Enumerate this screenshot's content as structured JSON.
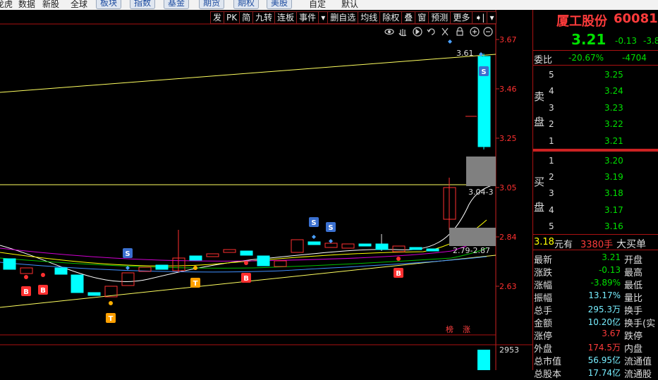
{
  "top_nav": [
    "龙虎",
    "数据",
    "新股",
    "全球",
    "板块",
    "指数",
    "基金",
    "期货",
    "期权",
    "美股",
    "自定",
    "默认"
  ],
  "toolbar": [
    "发",
    "PK",
    "简",
    "九转",
    "连板",
    "事件",
    "▾",
    "删自选",
    "均线",
    "除权",
    "叠",
    "窗",
    "预测",
    "更多",
    "➧|",
    "▾"
  ],
  "chart": {
    "price_axis": [
      "3.67",
      "3.46",
      "3.25",
      "3.05",
      "2.84",
      "2.63"
    ],
    "volume_label": "2953",
    "labels": {
      "high_price": "3.61",
      "mid_range": "3.04-3",
      "low_range": "2.79-2.87"
    },
    "tags": {
      "bang": "榜",
      "zhang": "涨"
    },
    "markers": {
      "buy": "B",
      "sell": "S",
      "t": "T"
    },
    "colors": {
      "up": "#ff3030",
      "down": "#00ffff",
      "axis": "#ff2020",
      "ma_white": "#ffffff",
      "ma_yellow": "#ffff00",
      "ma_purple": "#d000d0",
      "ma_green": "#00c000",
      "ma_blue": "#4090ff"
    }
  },
  "stock": {
    "name": "厦工股份",
    "code": "60081",
    "price": "3.21",
    "change": "-0.13",
    "change_pct": "-3.8"
  },
  "weibi": {
    "label": "委比",
    "pct": "-20.67%",
    "diff": "-4704"
  },
  "sell_side": {
    "label1": "卖",
    "label2": "盘",
    "levels": [
      {
        "n": "5",
        "price": "3.25"
      },
      {
        "n": "4",
        "price": "3.24"
      },
      {
        "n": "3",
        "price": "3.23"
      },
      {
        "n": "2",
        "price": "3.22"
      },
      {
        "n": "1",
        "price": "3.21"
      }
    ]
  },
  "buy_side": {
    "label1": "买",
    "label2": "盘",
    "levels": [
      {
        "n": "1",
        "price": "3.20"
      },
      {
        "n": "2",
        "price": "3.19"
      },
      {
        "n": "3",
        "price": "3.18"
      },
      {
        "n": "4",
        "price": "3.17"
      },
      {
        "n": "5",
        "price": "3.16"
      }
    ]
  },
  "big_order": {
    "price": "3.18",
    "unit": "元有",
    "vol": "3380手",
    "label": "大买单"
  },
  "stats": [
    {
      "k": "最新",
      "v": "3.21",
      "k2": "开盘"
    },
    {
      "k": "涨跌",
      "v": "-0.13",
      "k2": "最高"
    },
    {
      "k": "涨幅",
      "v": "-3.89%",
      "k2": "最低"
    },
    {
      "k": "振幅",
      "v": "13.17%",
      "k2": "量比"
    },
    {
      "k": "总手",
      "v": "295.3万",
      "k2": "换手"
    },
    {
      "k": "金额",
      "v": "10.20亿",
      "k2": "换手(实"
    },
    {
      "k": "涨停",
      "v": "3.67",
      "k2": "跌停"
    },
    {
      "k": "外盘",
      "v": "174.5万",
      "k2": "内盘"
    },
    {
      "k": "总市值",
      "v": "56.95亿",
      "k2": "流通值"
    },
    {
      "k": "总股本",
      "v": "17.74亿",
      "k2": "流通股"
    }
  ]
}
